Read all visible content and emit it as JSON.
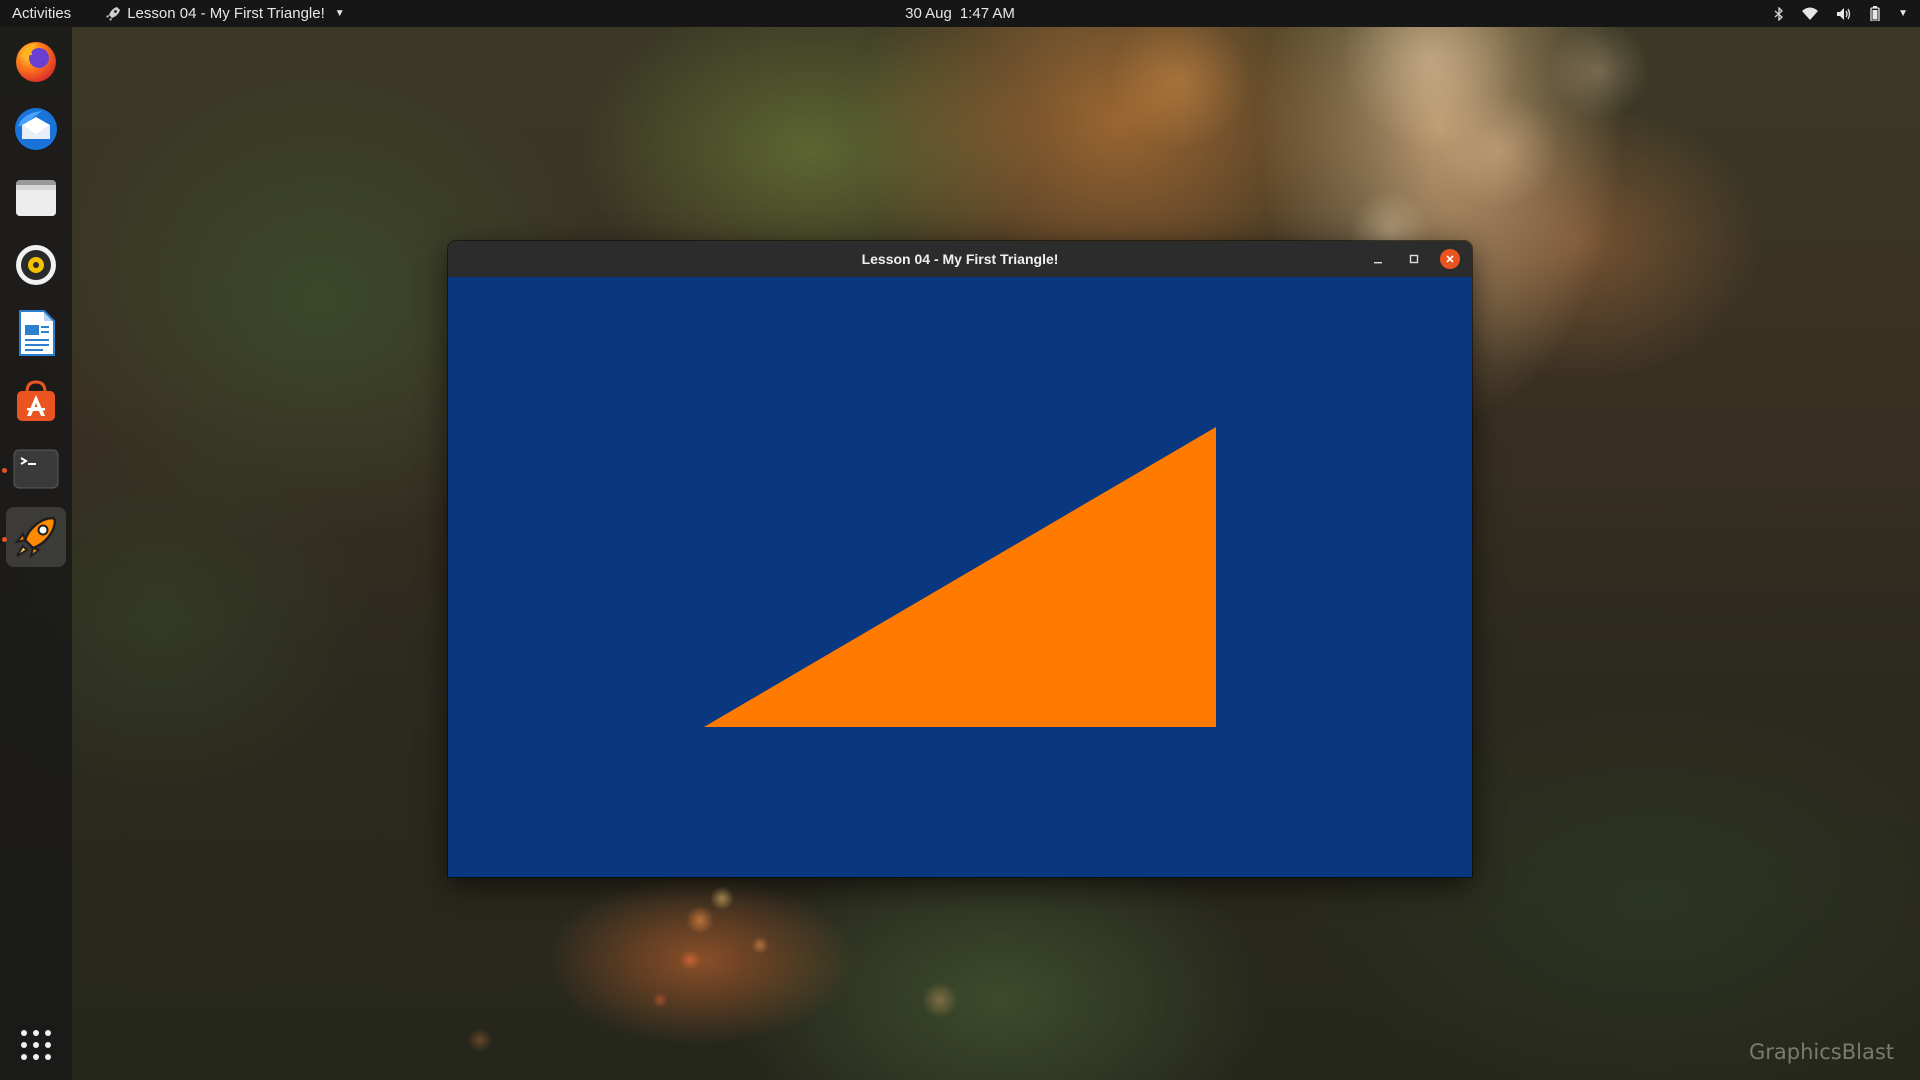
{
  "topbar": {
    "activities_label": "Activities",
    "app_title": "Lesson 04 - My First Triangle!",
    "app_icon": "rocket-icon",
    "date": "30 Aug",
    "time": "1:47 AM",
    "tray_icons": [
      "bluetooth-icon",
      "wifi-icon",
      "volume-icon",
      "battery-icon",
      "system-menu-caret-icon"
    ]
  },
  "dock": {
    "items": [
      {
        "name": "Firefox",
        "icon": "firefox-icon"
      },
      {
        "name": "Thunderbird",
        "icon": "thunderbird-icon"
      },
      {
        "name": "Files",
        "icon": "files-icon"
      },
      {
        "name": "Rhythmbox",
        "icon": "rhythmbox-icon"
      },
      {
        "name": "LibreOffice Writer",
        "icon": "libreoffice-writer-icon"
      },
      {
        "name": "Ubuntu Software",
        "icon": "ubuntu-software-icon"
      },
      {
        "name": "Terminal",
        "icon": "terminal-icon",
        "running": true
      },
      {
        "name": "Lesson 04 - My First Triangle!",
        "icon": "rocket-icon",
        "running": true,
        "focused": true
      }
    ],
    "show_apps_icon": "show-applications-icon"
  },
  "window": {
    "title": "Lesson 04 - My First Triangle!",
    "controls": [
      "minimize-icon",
      "maximize-icon",
      "close-icon"
    ],
    "clear_color": "#0a3880",
    "triangle_color": "#ff7b00",
    "triangle_vertices_ndc": [
      [
        -0.5,
        -0.5
      ],
      [
        0.5,
        -0.5
      ],
      [
        0.5,
        0.5
      ]
    ]
  },
  "watermark": "GraphicsBlast",
  "colors": {
    "topbar": "#161616",
    "accent_close": "#e95420",
    "running_dot": "#e95420"
  }
}
